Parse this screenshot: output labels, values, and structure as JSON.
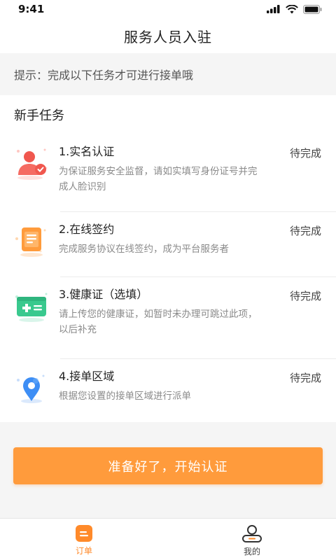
{
  "status": {
    "time": "9:41"
  },
  "nav": {
    "title": "服务人员入驻"
  },
  "tip": {
    "text": "提示：完成以下任务才可进行接单哦"
  },
  "section": {
    "title": "新手任务"
  },
  "tasks": [
    {
      "title": "1.实名认证",
      "desc": "为保证服务安全监督，请如实填写身份证号并完成人脸识别",
      "status": "待完成",
      "icon": "real-name-icon"
    },
    {
      "title": "2.在线签约",
      "desc": "完成服务协议在线签约，成为平台服务者",
      "status": "待完成",
      "icon": "contract-icon"
    },
    {
      "title": "3.健康证（选填）",
      "desc": "请上传您的健康证，如暂时未办理可跳过此项，以后补充",
      "status": "待完成",
      "icon": "health-card-icon"
    },
    {
      "title": "4.接单区域",
      "desc": "根据您设置的接单区域进行派单",
      "status": "待完成",
      "icon": "location-icon"
    }
  ],
  "action": {
    "label": "准备好了，开始认证"
  },
  "tabbar": {
    "items": [
      {
        "label": "订单",
        "active": true,
        "icon": "order-icon"
      },
      {
        "label": "我的",
        "active": false,
        "icon": "profile-icon"
      }
    ]
  },
  "colors": {
    "accent": "#ff9b3c",
    "tab_active": "#ff8a2a",
    "red_icon": "#f0574e",
    "blue_icon": "#3d8ef5",
    "green_icon": "#39c98e"
  }
}
